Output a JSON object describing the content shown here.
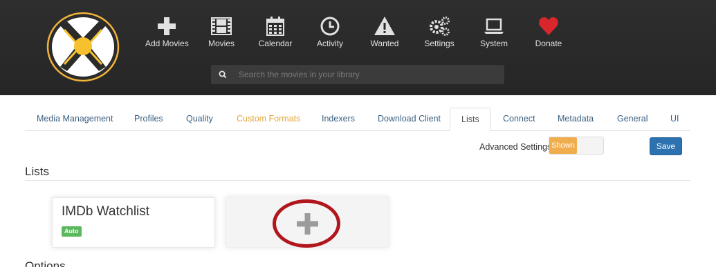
{
  "nav": {
    "items": [
      {
        "label": "Add Movies",
        "icon": "plus-icon"
      },
      {
        "label": "Movies",
        "icon": "film-icon"
      },
      {
        "label": "Calendar",
        "icon": "calendar-icon"
      },
      {
        "label": "Activity",
        "icon": "clock-icon"
      },
      {
        "label": "Wanted",
        "icon": "warning-icon"
      },
      {
        "label": "Settings",
        "icon": "gears-icon"
      },
      {
        "label": "System",
        "icon": "laptop-icon"
      },
      {
        "label": "Donate",
        "icon": "heart-icon"
      }
    ],
    "search_placeholder": "Search the movies in your library"
  },
  "tabs": [
    {
      "label": "Media Management"
    },
    {
      "label": "Profiles"
    },
    {
      "label": "Quality"
    },
    {
      "label": "Custom Formats"
    },
    {
      "label": "Indexers"
    },
    {
      "label": "Download Client"
    },
    {
      "label": "Lists"
    },
    {
      "label": "Connect"
    },
    {
      "label": "Metadata"
    },
    {
      "label": "General"
    },
    {
      "label": "UI"
    }
  ],
  "settings": {
    "advanced_label": "Advanced Settings",
    "advanced_state": "Shown",
    "save_label": "Save"
  },
  "lists": {
    "title": "Lists",
    "items": [
      {
        "name": "IMDb Watchlist",
        "badge": "Auto"
      }
    ]
  },
  "options": {
    "title": "Options"
  },
  "colors": {
    "header_bg": "#2b2b2b",
    "tab_link": "#3a5f80",
    "advanced_tab": "#e2a53b",
    "toggle_on": "#f0ad4e",
    "save_button": "#2d72b0",
    "badge": "#5cb85c",
    "highlight_ring": "#b0161c",
    "donate_heart": "#d9262c"
  }
}
